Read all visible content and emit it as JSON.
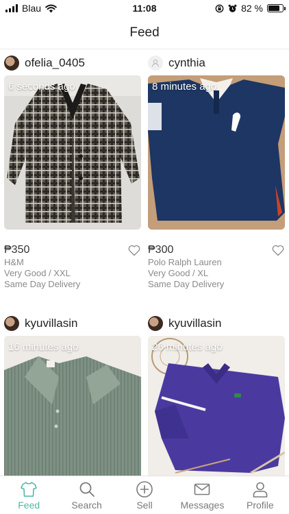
{
  "status_bar": {
    "carrier": "Blau",
    "time": "11:08",
    "battery_percent": "82 %",
    "battery_level": 0.82
  },
  "header": {
    "title": "Feed"
  },
  "feed": {
    "items": [
      {
        "username": "ofelia_0405",
        "time_ago": "6 seconds ago",
        "price": "₱350",
        "brand": "H&M",
        "condition_size": "Very Good / XXL",
        "delivery": "Same Day Delivery",
        "image_icon": "plaid-blazer-photo"
      },
      {
        "username": "cynthia",
        "time_ago": "8 minutes ago",
        "price": "₱300",
        "brand": "Polo Ralph Lauren",
        "condition_size": "Very Good / XL",
        "delivery": "Same Day Delivery",
        "image_icon": "navy-polo-shirt-photo"
      },
      {
        "username": "kyuvillasin",
        "time_ago": "16 minutes ago",
        "image_icon": "sage-ribbed-top-photo"
      },
      {
        "username": "kyuvillasin",
        "time_ago": "26 minutes ago",
        "image_icon": "purple-polo-shirt-photo"
      }
    ]
  },
  "tabbar": {
    "active_color": "#4db8a3",
    "tabs": [
      {
        "label": "Feed",
        "icon": "shirt-icon"
      },
      {
        "label": "Search",
        "icon": "search-icon"
      },
      {
        "label": "Sell",
        "icon": "plus-circle-icon"
      },
      {
        "label": "Messages",
        "icon": "envelope-icon"
      },
      {
        "label": "Profile",
        "icon": "person-icon"
      }
    ]
  }
}
